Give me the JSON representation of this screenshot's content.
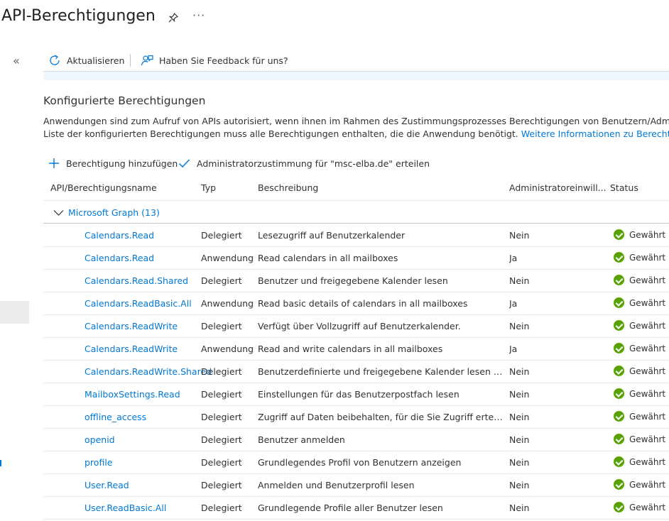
{
  "page": {
    "title": "API-Berechtigungen"
  },
  "toolbar": {
    "refresh_label": "Aktualisieren",
    "feedback_label": "Haben Sie Feedback für uns?"
  },
  "section": {
    "title": "Konfigurierte Berechtigungen",
    "description_line1": "Anwendungen sind zum Aufruf von APIs autorisiert, wenn ihnen im Rahmen des Zustimmungsprozesses Berechtigungen von Benutzern/Administratoren",
    "description_line2": "Liste der konfigurierten Berechtigungen muss alle Berechtigungen enthalten, die die Anwendung benötigt.",
    "learn_more_link": "Weitere Informationen zu Berechtigungen und"
  },
  "actions": {
    "add_permission": "Berechtigung hinzufügen",
    "grant_admin_consent": "Administratorzustimmung für \"msc-elba.de\" erteilen"
  },
  "table": {
    "columns": {
      "name": "API/Berechtigungsname",
      "type": "Typ",
      "description": "Beschreibung",
      "admin": "Administratoreinwill...",
      "status": "Status"
    },
    "group": {
      "label": "Microsoft Graph (13)"
    },
    "rows": [
      {
        "name": "Calendars.Read",
        "type": "Delegiert",
        "description": "Lesezugriff auf Benutzerkalender",
        "admin": "Nein",
        "status": "Gewährt"
      },
      {
        "name": "Calendars.Read",
        "type": "Anwendung",
        "description": "Read calendars in all mailboxes",
        "admin": "Ja",
        "status": "Gewährt"
      },
      {
        "name": "Calendars.Read.Shared",
        "type": "Delegiert",
        "description": "Benutzer und freigegebene Kalender lesen",
        "admin": "Nein",
        "status": "Gewährt"
      },
      {
        "name": "Calendars.ReadBasic.All",
        "type": "Anwendung",
        "description": "Read basic details of calendars in all mailboxes",
        "admin": "Ja",
        "status": "Gewährt"
      },
      {
        "name": "Calendars.ReadWrite",
        "type": "Delegiert",
        "description": "Verfügt über Vollzugriff auf Benutzerkalender.",
        "admin": "Nein",
        "status": "Gewährt"
      },
      {
        "name": "Calendars.ReadWrite",
        "type": "Anwendung",
        "description": "Read and write calendars in all mailboxes",
        "admin": "Ja",
        "status": "Gewährt"
      },
      {
        "name": "Calendars.ReadWrite.Shared",
        "type": "Delegiert",
        "description": "Benutzerdefinierte und freigegebene Kalender lesen und ...",
        "admin": "Nein",
        "status": "Gewährt"
      },
      {
        "name": "MailboxSettings.Read",
        "type": "Delegiert",
        "description": "Einstellungen für das Benutzerpostfach lesen",
        "admin": "Nein",
        "status": "Gewährt"
      },
      {
        "name": "offline_access",
        "type": "Delegiert",
        "description": "Zugriff auf Daten beibehalten, für die Sie Zugriff erteilt ha...",
        "admin": "Nein",
        "status": "Gewährt"
      },
      {
        "name": "openid",
        "type": "Delegiert",
        "description": "Benutzer anmelden",
        "admin": "Nein",
        "status": "Gewährt"
      },
      {
        "name": "profile",
        "type": "Delegiert",
        "description": "Grundlegendes Profil von Benutzern anzeigen",
        "admin": "Nein",
        "status": "Gewährt"
      },
      {
        "name": "User.Read",
        "type": "Delegiert",
        "description": "Anmelden und Benutzerprofil lesen",
        "admin": "Nein",
        "status": "Gewährt"
      },
      {
        "name": "User.ReadBasic.All",
        "type": "Delegiert",
        "description": "Grundlegende Profile aller Benutzer lesen",
        "admin": "Nein",
        "status": "Gewährt"
      }
    ]
  },
  "colors": {
    "accent": "#0078d4",
    "granted": "#57a300",
    "text": "#323130"
  },
  "icons": {
    "pin": "pin-icon",
    "more": "more-icon",
    "collapse": "double-chevron-left-icon",
    "refresh": "refresh-icon",
    "feedback": "feedback-icon",
    "add": "plus-icon",
    "consent": "checkmark-icon",
    "group_toggle": "chevron-down-icon",
    "granted": "check-circle-icon"
  }
}
